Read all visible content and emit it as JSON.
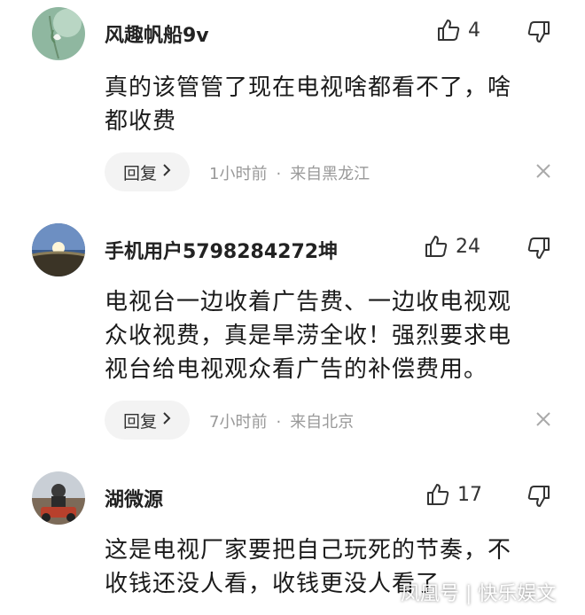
{
  "comments": [
    {
      "username": "风趣帆船9v",
      "likes": "4",
      "content_lines": [
        "真的该管管了现在电视啥都看不了，啥",
        "都收费"
      ],
      "reply_label": "回复",
      "time": "1小时前",
      "separator": "·",
      "location": "来自黑龙江"
    },
    {
      "username": "手机用户5798284272坤",
      "likes": "24",
      "content_lines": [
        "电视台一边收着广告费、一边收电视观",
        "众收视费，真是旱涝全收！强烈要求电",
        "视台给电视观众看广告的补偿费用。"
      ],
      "reply_label": "回复",
      "time": "7小时前",
      "separator": "·",
      "location": "来自北京"
    },
    {
      "username": "湖微源",
      "likes": "17",
      "content_lines": [
        "这是电视厂家要把自己玩死的节奏，不",
        "收钱还没人看，收钱更没人看了"
      ]
    }
  ],
  "watermark": "凤凰号 | 快乐娱文",
  "icons": {
    "like": "thumbs-up-icon",
    "dislike": "thumbs-down-icon",
    "reply_arrow": "chevron-right-icon",
    "close": "close-icon"
  },
  "colors": {
    "meta": "#999999",
    "reply_bg": "#f3f3f3",
    "text": "#1a1a1a"
  }
}
